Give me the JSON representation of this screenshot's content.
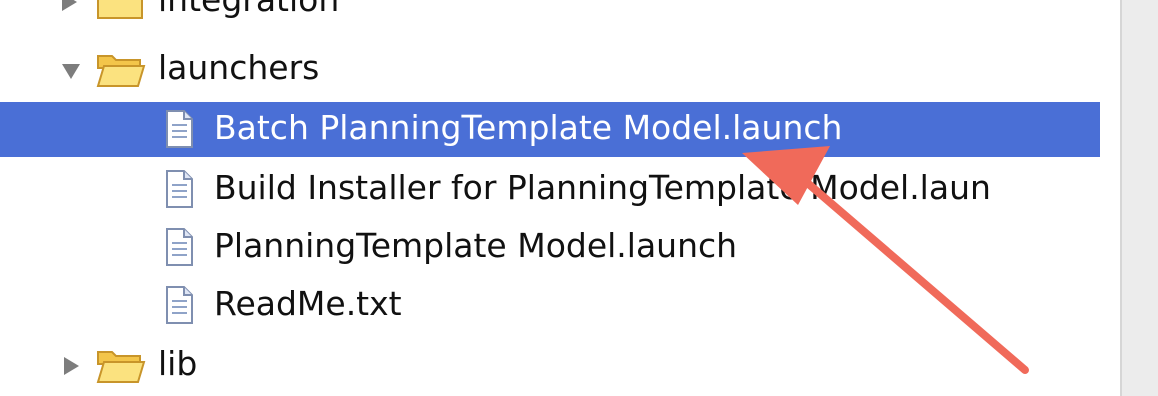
{
  "tree": {
    "rows": [
      {
        "label": "integration",
        "kind": "folder",
        "state": "closed"
      },
      {
        "label": "launchers",
        "kind": "folder",
        "state": "open"
      },
      {
        "label": "Batch PlanningTemplate Model.launch",
        "kind": "file",
        "selected": true
      },
      {
        "label": "Build Installer for PlanningTemplate Model.laun",
        "kind": "file"
      },
      {
        "label": "PlanningTemplate Model.launch",
        "kind": "file"
      },
      {
        "label": "ReadMe.txt",
        "kind": "file"
      },
      {
        "label": "lib",
        "kind": "folder",
        "state": "closed"
      }
    ]
  },
  "colors": {
    "selection": "#4a6fd6",
    "arrow": "#f06a5a",
    "folder": "#f3c54a"
  }
}
